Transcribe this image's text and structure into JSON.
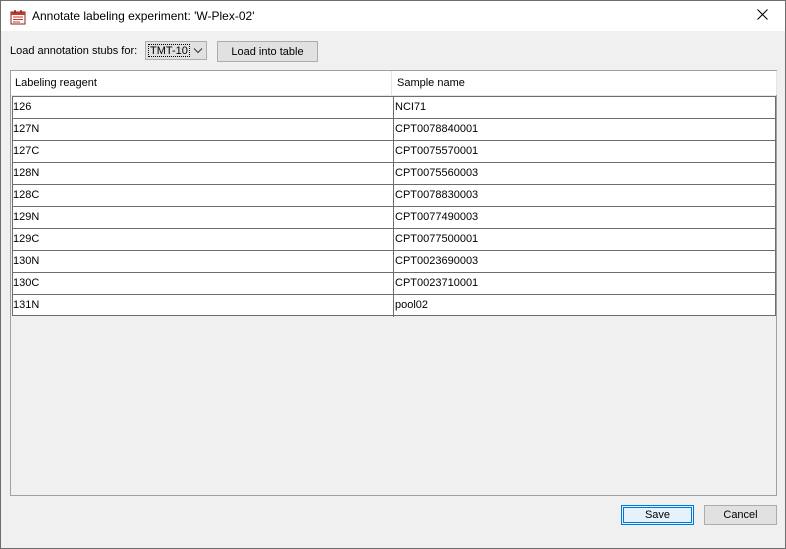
{
  "window": {
    "title": "Annotate labeling experiment: 'W-Plex-02'",
    "icon": "lab-icon",
    "close_icon": "close-icon"
  },
  "toolbar": {
    "load_label": "Load annotation stubs for:",
    "combo_value": "TMT-10",
    "load_button": "Load into table"
  },
  "table": {
    "columns": [
      "Labeling reagent",
      "Sample name"
    ],
    "rows": [
      {
        "reagent": "126",
        "sample": "NCI71"
      },
      {
        "reagent": "127N",
        "sample": "CPT0078840001"
      },
      {
        "reagent": "127C",
        "sample": "CPT0075570001"
      },
      {
        "reagent": "128N",
        "sample": "CPT0075560003"
      },
      {
        "reagent": "128C",
        "sample": "CPT0078830003"
      },
      {
        "reagent": "129N",
        "sample": "CPT0077490003"
      },
      {
        "reagent": "129C",
        "sample": "CPT0077500001"
      },
      {
        "reagent": "130N",
        "sample": "CPT0023690003"
      },
      {
        "reagent": "130C",
        "sample": "CPT0023710001"
      },
      {
        "reagent": "131N",
        "sample": "pool02"
      }
    ]
  },
  "footer": {
    "save": "Save",
    "cancel": "Cancel"
  }
}
